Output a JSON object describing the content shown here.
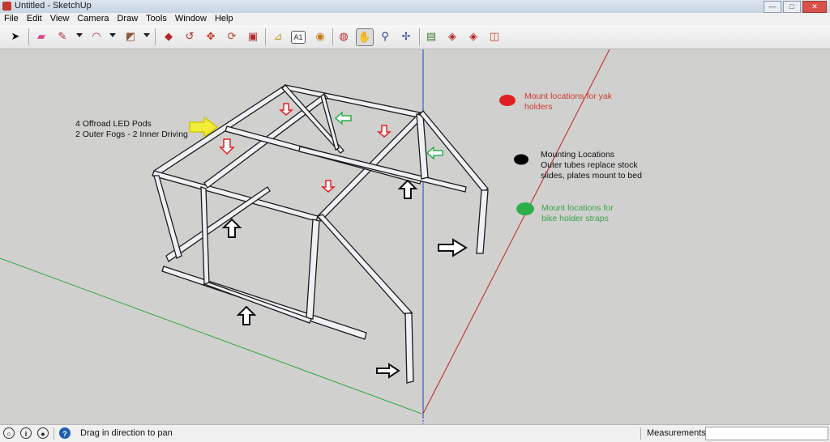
{
  "window": {
    "title": "Untitled - SketchUp"
  },
  "menu": [
    "File",
    "Edit",
    "View",
    "Camera",
    "Draw",
    "Tools",
    "Window",
    "Help"
  ],
  "toolbar": {
    "tools": [
      {
        "name": "select-tool",
        "icon": "arrow-cursor-icon",
        "glyph": "➤",
        "color": "#111111"
      },
      {
        "name": "eraser-tool",
        "icon": "eraser-icon",
        "glyph": "▰",
        "color": "#d64a8a"
      },
      {
        "name": "pencil-tool",
        "icon": "pencil-icon",
        "glyph": "✎",
        "color": "#b5262b"
      },
      {
        "name": "arc-tool",
        "icon": "arc-icon",
        "glyph": "◠",
        "color": "#b5262b"
      },
      {
        "name": "rectangle-tool",
        "icon": "rectangle-icon",
        "glyph": "◩",
        "color": "#8a5a3c"
      },
      {
        "name": "push-pull-tool",
        "icon": "push-pull-icon",
        "glyph": "◆",
        "color": "#b5262b"
      },
      {
        "name": "follow-me-tool",
        "icon": "follow-me-icon",
        "glyph": "↺",
        "color": "#b5262b"
      },
      {
        "name": "move-tool",
        "icon": "move-icon",
        "glyph": "✥",
        "color": "#c0392b"
      },
      {
        "name": "rotate-tool",
        "icon": "rotate-icon",
        "glyph": "⟳",
        "color": "#c0392b"
      },
      {
        "name": "offset-tool",
        "icon": "offset-icon",
        "glyph": "▣",
        "color": "#b5262b"
      },
      {
        "name": "tape-measure-tool",
        "icon": "tape-measure-icon",
        "glyph": "⊿",
        "color": "#c29a1c"
      },
      {
        "name": "text-tool",
        "icon": "text-icon",
        "glyph": "A1",
        "color": "#222222"
      },
      {
        "name": "paint-bucket-tool",
        "icon": "paint-bucket-icon",
        "glyph": "◉",
        "color": "#c47b12"
      },
      {
        "name": "orbit-tool",
        "icon": "orbit-icon",
        "glyph": "◍",
        "color": "#b5262b"
      },
      {
        "name": "pan-tool",
        "icon": "hand-icon",
        "glyph": "✋",
        "color": "#333333"
      },
      {
        "name": "zoom-tool",
        "icon": "magnifier-icon",
        "glyph": "⚲",
        "color": "#1f3f8a"
      },
      {
        "name": "zoom-extents-tool",
        "icon": "zoom-extents-icon",
        "glyph": "✢",
        "color": "#1f3f8a"
      },
      {
        "name": "get-models-tool",
        "icon": "warehouse-icon",
        "glyph": "▤",
        "color": "#3a7d2c"
      },
      {
        "name": "share-model-tool",
        "icon": "share-model-icon",
        "glyph": "◈",
        "color": "#b5262b"
      },
      {
        "name": "share-component-tool",
        "icon": "share-component-icon",
        "glyph": "◈",
        "color": "#b5262b"
      },
      {
        "name": "extension-warehouse-tool",
        "icon": "extension-icon",
        "glyph": "◫",
        "color": "#c0392b"
      }
    ]
  },
  "annotations": {
    "led_pods": [
      "4 Offroad LED Pods",
      "2 Outer Fogs - 2 Inner Driving"
    ],
    "yak": [
      "Mount locations for yak",
      "holders"
    ],
    "mounting": [
      "Mounting Locations",
      "Outer tubes replace stock",
      "slides, plates mount to bed"
    ],
    "bike": [
      "Mount locations for",
      "bike holder straps"
    ]
  },
  "legend_colors": {
    "red": "#e02020",
    "black": "#000000",
    "green": "#2db04b",
    "yellow": "#f2e600"
  },
  "status": {
    "message": "Drag in direction to pan",
    "measurements_label": "Measurements",
    "measurements_value": ""
  }
}
